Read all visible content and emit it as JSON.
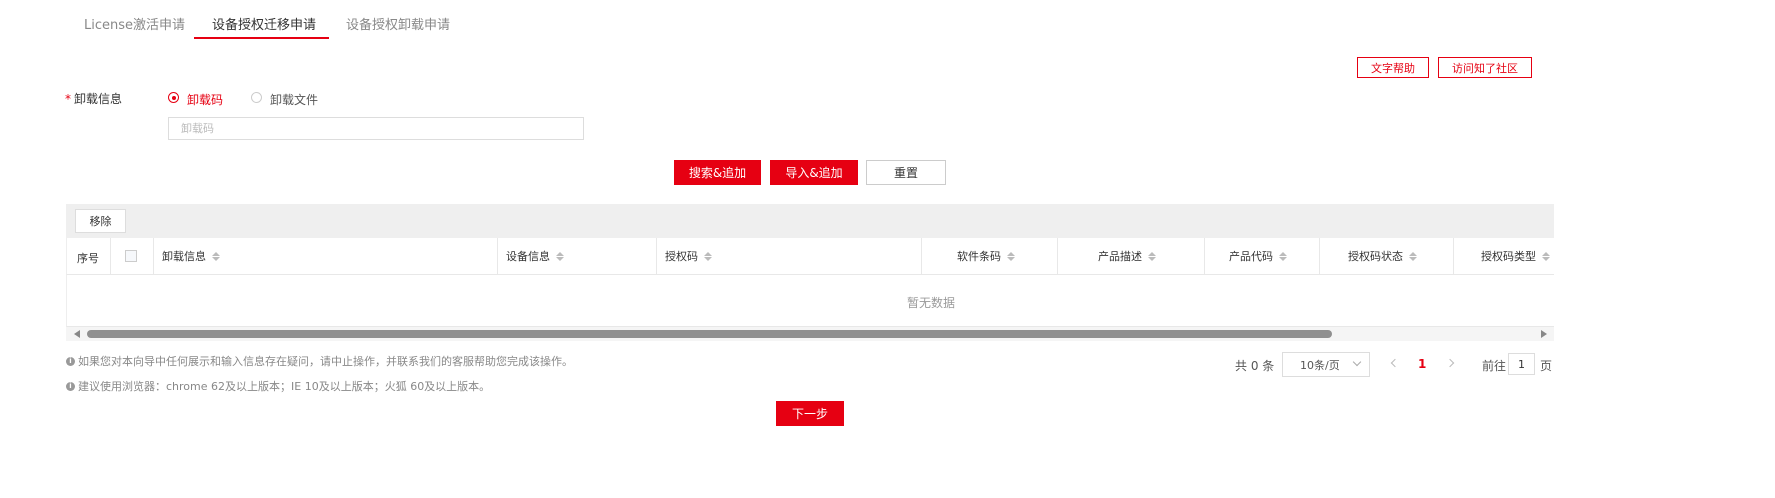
{
  "tabs": [
    {
      "label": "License激活申请",
      "active": false
    },
    {
      "label": "设备授权迁移申请",
      "active": true
    },
    {
      "label": "设备授权卸载申请",
      "active": false
    }
  ],
  "help": {
    "text_help": "文字帮助",
    "community": "访问知了社区"
  },
  "form": {
    "required_mark": "*",
    "label": "卸载信息",
    "radio_options": [
      {
        "label": "卸载码",
        "checked": true
      },
      {
        "label": "卸载文件",
        "checked": false
      }
    ],
    "input_placeholder": "卸载码",
    "input_value": ""
  },
  "actions": {
    "search_add": "搜索&追加",
    "import_add": "导入&追加",
    "reset": "重置"
  },
  "table": {
    "remove_label": "移除",
    "columns": [
      "序号",
      "卸载信息",
      "设备信息",
      "授权码",
      "软件条码",
      "产品描述",
      "产品代码",
      "授权码状态",
      "授权码类型"
    ],
    "empty_text": "暂无数据",
    "rows": []
  },
  "tips": [
    "如果您对本向导中任何展示和输入信息存在疑问，请中止操作，并联系我们的客服帮助您完成该操作。",
    "建议使用浏览器：chrome 62及以上版本；IE 10及以上版本；火狐 60及以上版本。"
  ],
  "pagination": {
    "total_text": "共 0 条",
    "page_size": "10条/页",
    "current_page": "1",
    "goto_label": "前往",
    "goto_value": "1",
    "page_unit": "页"
  },
  "next_label": "下一步",
  "colors": {
    "accent": "#e60012",
    "toolbar_bg": "#efefef"
  },
  "icons": {
    "info": "info-circle-icon",
    "sort": "sort-caret-icon"
  }
}
